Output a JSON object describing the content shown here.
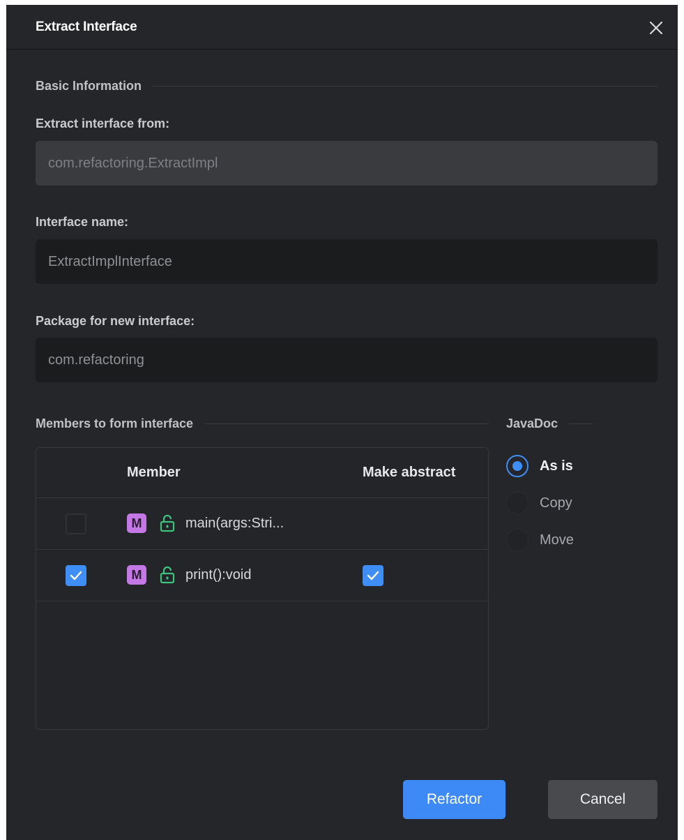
{
  "dialog": {
    "title": "Extract Interface"
  },
  "basic_info": {
    "heading": "Basic Information",
    "extract_from_label": "Extract interface from:",
    "extract_from_value": "com.refactoring.ExtractImpl",
    "interface_name_label": "Interface name:",
    "interface_name_value": "ExtractImplInterface",
    "package_label": "Package for new interface:",
    "package_value": "com.refactoring"
  },
  "members": {
    "heading": "Members to form interface",
    "columns": [
      "Member",
      "Make abstract"
    ],
    "rows": [
      {
        "badge": "M",
        "name": "main(args:Stri...",
        "selected": false,
        "make_abstract": null
      },
      {
        "badge": "M",
        "name": "print():void",
        "selected": true,
        "make_abstract": true
      }
    ]
  },
  "javadoc": {
    "heading": "JavaDoc",
    "options": [
      "As is",
      "Copy",
      "Move"
    ],
    "selected": "As is"
  },
  "buttons": {
    "refactor": "Refactor",
    "cancel": "Cancel"
  },
  "colors": {
    "background": "#252629",
    "accent": "#3f8ef5",
    "method_badge": "#c478e6",
    "public_lock": "#3dc47e"
  },
  "icons": {
    "close": "close-icon",
    "method": "method-badge-icon",
    "visibility": "unlock-icon",
    "check": "check-icon"
  }
}
